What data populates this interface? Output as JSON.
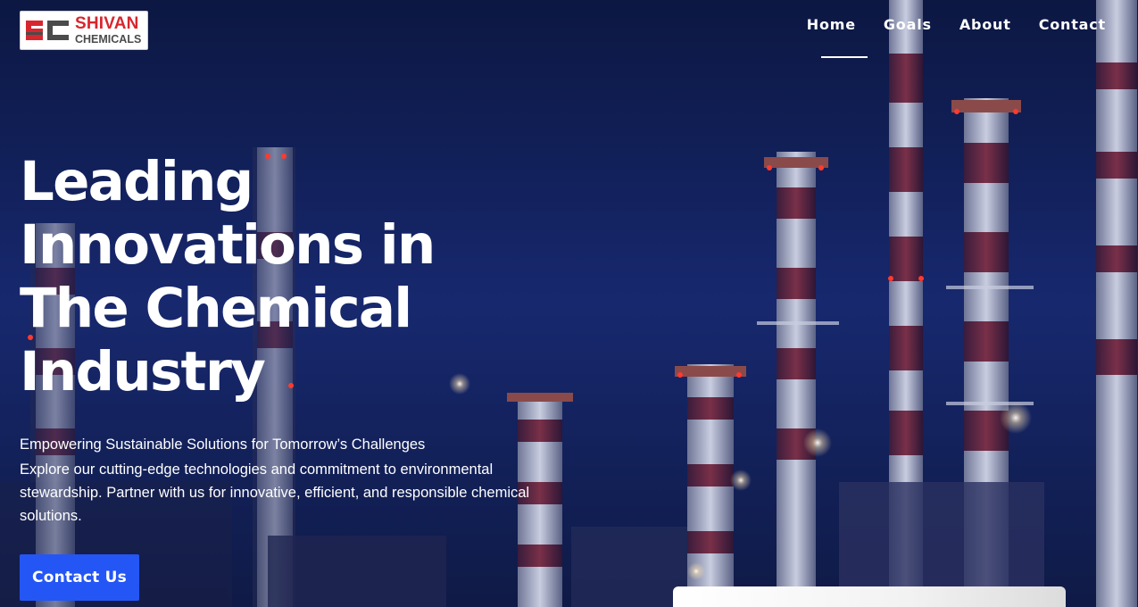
{
  "brand": {
    "name": "SHIVAN",
    "sub": "CHEMICALS",
    "logo_mark": "SC",
    "colors": {
      "red": "#d8262e",
      "gray": "#4b4b4b"
    }
  },
  "nav": {
    "items": [
      {
        "label": "Home",
        "active": true
      },
      {
        "label": "Goals"
      },
      {
        "label": "About"
      },
      {
        "label": "Contact"
      }
    ]
  },
  "hero": {
    "headline_lines": [
      "Leading",
      "Innovations in",
      "The Chemical",
      "Industry"
    ],
    "subtitle": "Empowering Sustainable Solutions for Tomorrow’s Challenges",
    "body": "Explore our cutting-edge technologies and commitment to environmental stewardship. Partner with us for innovative, efficient, and responsible chemical solutions.",
    "cta_label": "Contact Us",
    "background_icon": "refinery-night-photo"
  },
  "colors": {
    "accent": "#2456f5",
    "overlay": "#13246a"
  }
}
